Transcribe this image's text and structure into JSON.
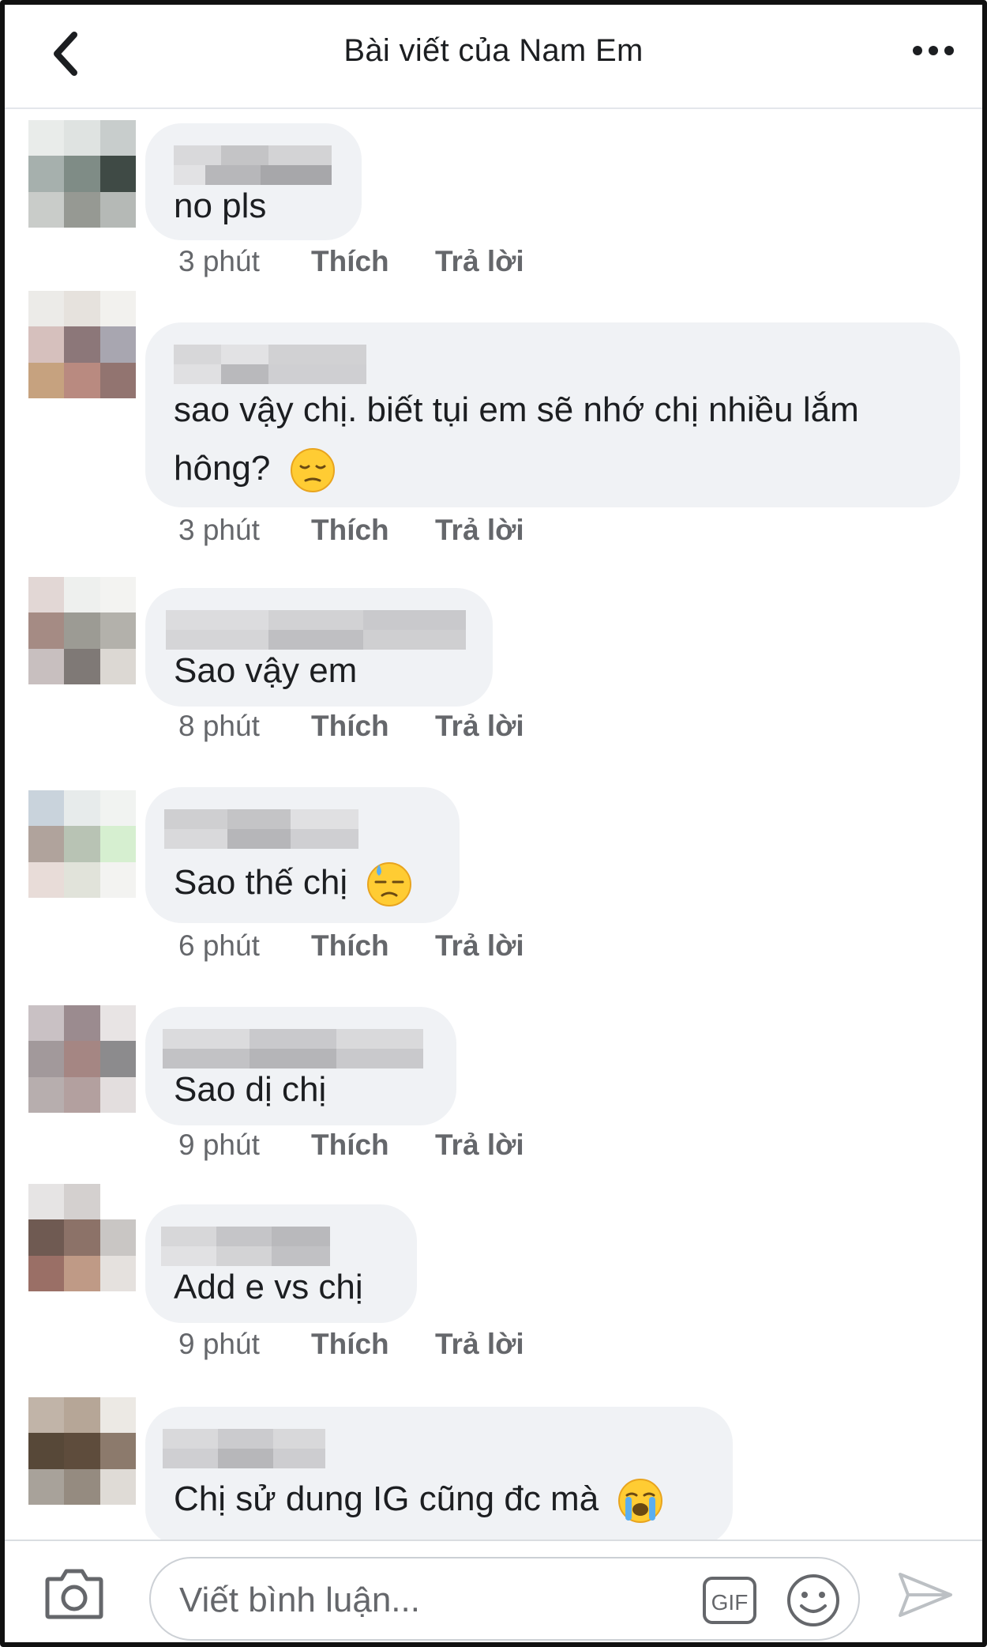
{
  "header": {
    "title": "Bài viết của Nam Em",
    "back_icon": "chevron-left-icon",
    "more_icon": "more-horizontal-icon"
  },
  "comments": [
    {
      "author": "(blurred)",
      "text": "no pls",
      "time": "3 phút",
      "like": "Thích",
      "reply": "Trả lời",
      "emoji": ""
    },
    {
      "author": "(blurred)",
      "text": "sao vậy chị. biết tụi em sẽ nhớ chị nhiều lắm hông?",
      "time": "3 phút",
      "like": "Thích",
      "reply": "Trả lời",
      "emoji": "pensive-face"
    },
    {
      "author": "(blurred)",
      "text": "Sao vậy em",
      "time": "8 phút",
      "like": "Thích",
      "reply": "Trả lời",
      "emoji": ""
    },
    {
      "author": "(blurred)",
      "text": "Sao thế chị",
      "time": "6 phút",
      "like": "Thích",
      "reply": "Trả lời",
      "emoji": "downcast-face-with-sweat"
    },
    {
      "author": "(blurred)",
      "text": "Sao dị chị",
      "time": "9 phút",
      "like": "Thích",
      "reply": "Trả lời",
      "emoji": ""
    },
    {
      "author": "(blurred)",
      "text": "Add e vs chị",
      "time": "9 phút",
      "like": "Thích",
      "reply": "Trả lời",
      "emoji": ""
    },
    {
      "author": "(blurred)",
      "text": "Chị sử dung IG cũng đc mà",
      "time": "",
      "like": "",
      "reply": "",
      "emoji": "loudly-crying-face"
    }
  ],
  "composer": {
    "placeholder": "Viết bình luận...",
    "camera_icon": "camera-icon",
    "gif_label": "GIF",
    "emoji_icon": "smiley-icon",
    "send_icon": "send-icon"
  },
  "colors": {
    "bubble": "#f0f2f5",
    "meta_text": "#65676b",
    "text": "#1c1e21"
  }
}
